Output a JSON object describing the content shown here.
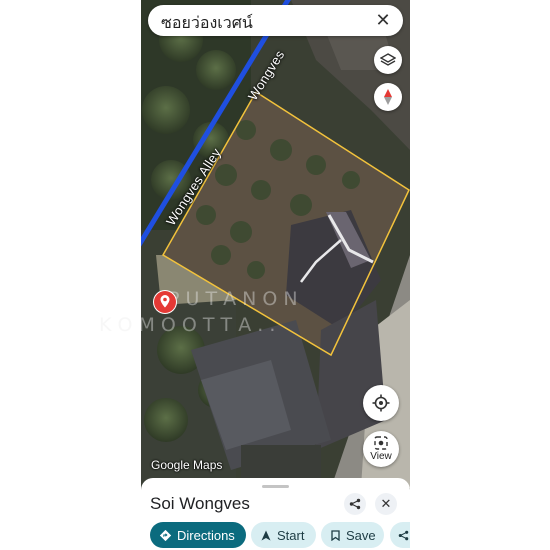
{
  "search": {
    "query": "ซอยว่องเวศน์"
  },
  "map": {
    "street_labels": [
      "Wongves",
      "Wongves Alley"
    ],
    "attribution": "Google Maps",
    "watermark_lines": [
      "P U T A N O N",
      "K O M O O T T A . ."
    ],
    "colors": {
      "road": "#1f4fe0",
      "boundary": "#f2c23c",
      "pin": "#e53935"
    }
  },
  "controls": {
    "view_label": "View"
  },
  "place": {
    "title": "Soi Wongves",
    "actions": {
      "directions": "Directions",
      "start": "Start",
      "save": "Save"
    }
  },
  "icons": [
    "layers-icon",
    "compass-icon",
    "my-location-icon",
    "view-camera-icon",
    "share-icon",
    "close-icon",
    "directions-icon",
    "navigation-arrow-icon",
    "bookmark-icon",
    "map-pin-icon"
  ]
}
